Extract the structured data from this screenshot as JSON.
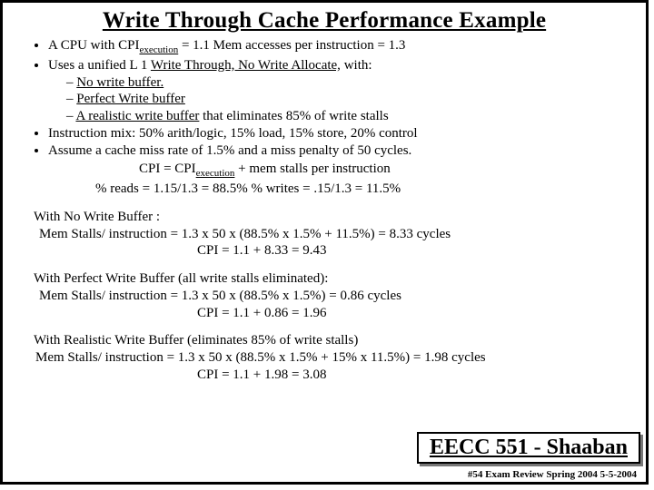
{
  "title": "Write Through Cache Performance Example",
  "bullets": {
    "b1_pre": "A CPU with  CPI",
    "b1_mid": " =  1.1  Mem accesses per instruction =  1.3",
    "b2_pre": "Uses a unified L 1 ",
    "b2_u": "Write Through, No Write Allocate,",
    "b2_post": " with:",
    "s1": "No write buffer.",
    "s2": "Perfect Write buffer",
    "s3_pre": "A realistic write buffer",
    "s3_post": " that eliminates 85% of write stalls",
    "b3": "Instruction mix:   50% arith/logic,  15% load,  15% store, 20% control",
    "b4": "Assume a cache miss rate of 1.5% and a miss penalty of 50 cycles.",
    "eq1_pre": "CPI =   CPI",
    "eq1_post": "   +   mem stalls per instruction",
    "eq2": "% reads =  1.15/1.3 =   88.5%           % writes =  .15/1.3 =  11.5%"
  },
  "noWB": {
    "h": "With No Write Buffer :",
    "l1": "Mem Stalls/ instruction =   1.3 x 50  x   (88.5%  x   1.5%  +   11.5%) = 8.33 cycles",
    "l2": "CPI =  1.1  + 8.33 =   9.43"
  },
  "perfWB": {
    "h": "With Perfect Write Buffer (all write stalls eliminated):",
    "l1": "Mem Stalls/ instruction =   1.3 x 50  x   (88.5%  x   1.5%)  = 0.86 cycles",
    "l2": "CPI =  1.1  + 0.86 =   1.96"
  },
  "realWB": {
    "h": "With Realistic Write Buffer (eliminates 85% of write stalls)",
    "l1": " Mem Stalls/ instruction =   1.3 x 50  x   (88.5%  x   1.5%  +  15% x 11.5%) = 1.98 cycles",
    "l2": "CPI =  1.1  + 1.98 =   3.08"
  },
  "corner": "EECC 551 - Shaaban",
  "footer": "#54   Exam Review  Spring 2004  5-5-2004",
  "sub": "execution"
}
